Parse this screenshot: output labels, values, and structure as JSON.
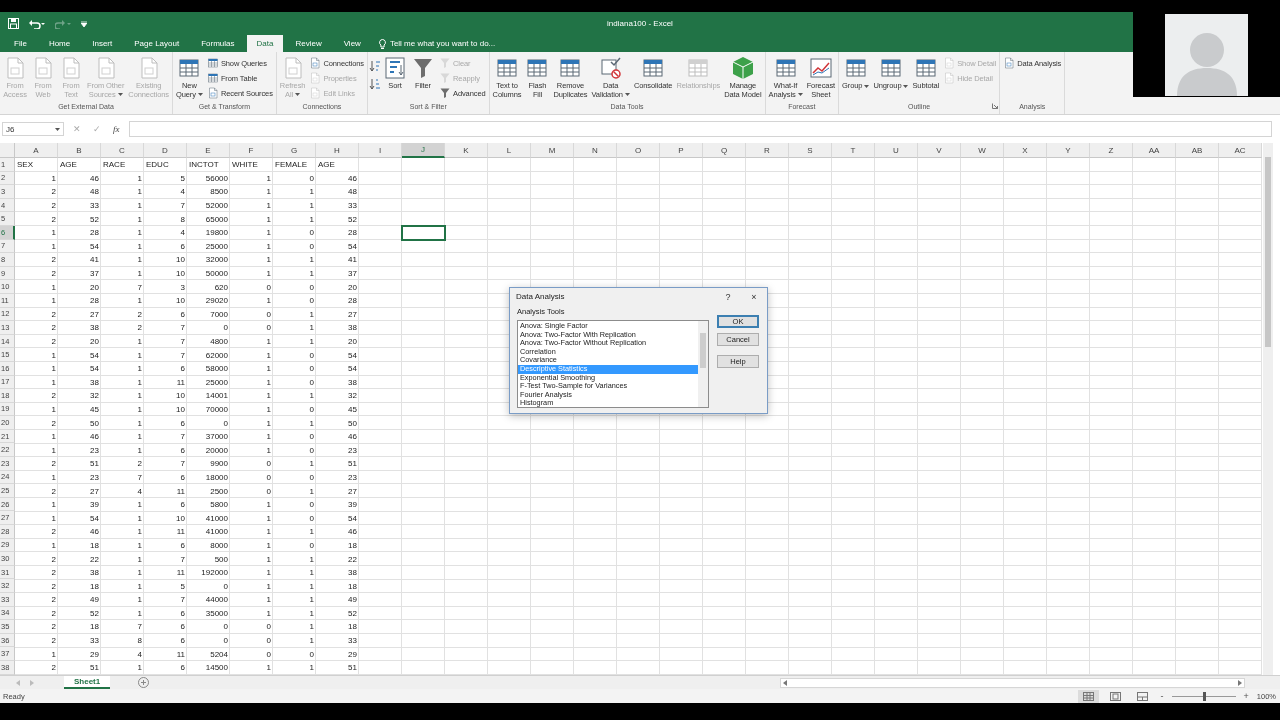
{
  "window": {
    "title": "indiana100 - Excel"
  },
  "tabs": [
    {
      "label": "File",
      "selected": false
    },
    {
      "label": "Home",
      "selected": false
    },
    {
      "label": "Insert",
      "selected": false
    },
    {
      "label": "Page Layout",
      "selected": false
    },
    {
      "label": "Formulas",
      "selected": false
    },
    {
      "label": "Data",
      "selected": true
    },
    {
      "label": "Review",
      "selected": false
    },
    {
      "label": "View",
      "selected": false
    }
  ],
  "tell_me": {
    "placeholder": "Tell me what you want to do..."
  },
  "ribbon": {
    "groups": [
      {
        "label": "Get External Data",
        "launcher": false,
        "items": [
          {
            "kind": "large",
            "label": "From\nAccess",
            "disabled": true,
            "menu": false
          },
          {
            "kind": "large",
            "label": "From\nWeb",
            "disabled": true,
            "menu": false
          },
          {
            "kind": "large",
            "label": "From\nText",
            "disabled": true,
            "menu": false
          },
          {
            "kind": "large",
            "label": "From Other\nSources",
            "disabled": true,
            "menu": true
          },
          {
            "kind": "large",
            "label": "Existing\nConnections",
            "disabled": true,
            "menu": false
          }
        ]
      },
      {
        "label": "Get & Transform",
        "launcher": false,
        "items": [
          {
            "kind": "large",
            "label": "New\nQuery",
            "disabled": false,
            "menu": true
          },
          {
            "kind": "stack",
            "items": [
              {
                "label": "Show Queries",
                "disabled": false
              },
              {
                "label": "From Table",
                "disabled": false
              },
              {
                "label": "Recent Sources",
                "disabled": false
              }
            ]
          }
        ]
      },
      {
        "label": "Connections",
        "launcher": false,
        "items": [
          {
            "kind": "large",
            "label": "Refresh\nAll",
            "disabled": true,
            "menu": true
          },
          {
            "kind": "stack",
            "items": [
              {
                "label": "Connections",
                "disabled": false
              },
              {
                "label": "Properties",
                "disabled": true
              },
              {
                "label": "Edit Links",
                "disabled": true
              }
            ]
          }
        ]
      },
      {
        "label": "Sort & Filter",
        "launcher": false,
        "items": [
          {
            "kind": "sort_icons"
          },
          {
            "kind": "large",
            "label": "Sort",
            "disabled": false,
            "menu": false
          },
          {
            "kind": "large",
            "label": "Filter",
            "disabled": false,
            "menu": false
          },
          {
            "kind": "stack",
            "items": [
              {
                "label": "Clear",
                "disabled": true
              },
              {
                "label": "Reapply",
                "disabled": true
              },
              {
                "label": "Advanced",
                "disabled": false
              }
            ]
          }
        ]
      },
      {
        "label": "Data Tools",
        "launcher": false,
        "items": [
          {
            "kind": "large",
            "label": "Text to\nColumns",
            "disabled": false,
            "menu": false
          },
          {
            "kind": "large",
            "label": "Flash\nFill",
            "disabled": false,
            "menu": false
          },
          {
            "kind": "large",
            "label": "Remove\nDuplicates",
            "disabled": false,
            "menu": false
          },
          {
            "kind": "large",
            "label": "Data\nValidation",
            "disabled": false,
            "menu": true
          },
          {
            "kind": "large",
            "label": "Consolidate",
            "disabled": false,
            "menu": false
          },
          {
            "kind": "large",
            "label": "Relationships",
            "disabled": true,
            "menu": false
          },
          {
            "kind": "large",
            "label": "Manage\nData Model",
            "disabled": false,
            "menu": false
          }
        ]
      },
      {
        "label": "Forecast",
        "launcher": false,
        "items": [
          {
            "kind": "large",
            "label": "What-If\nAnalysis",
            "disabled": false,
            "menu": true
          },
          {
            "kind": "large",
            "label": "Forecast\nSheet",
            "disabled": false,
            "menu": false
          }
        ]
      },
      {
        "label": "Outline",
        "launcher": true,
        "items": [
          {
            "kind": "large",
            "label": "Group",
            "disabled": false,
            "menu": true
          },
          {
            "kind": "large",
            "label": "Ungroup",
            "disabled": false,
            "menu": true
          },
          {
            "kind": "large",
            "label": "Subtotal",
            "disabled": false,
            "menu": false
          },
          {
            "kind": "stack",
            "items": [
              {
                "label": "Show Detail",
                "disabled": true
              },
              {
                "label": "Hide Detail",
                "disabled": true
              }
            ]
          }
        ]
      },
      {
        "label": "Analysis",
        "launcher": false,
        "items": [
          {
            "kind": "stack",
            "items": [
              {
                "label": "Data Analysis",
                "disabled": false
              }
            ]
          }
        ]
      }
    ]
  },
  "formula_bar": {
    "name_box": "J6",
    "cancel": "✕",
    "enter": "✓",
    "insert_function": "fx"
  },
  "sheet": {
    "columns": [
      {
        "label": "A",
        "selected": false
      },
      {
        "label": "B",
        "selected": false
      },
      {
        "label": "C",
        "selected": false
      },
      {
        "label": "D",
        "selected": false
      },
      {
        "label": "E",
        "selected": false
      },
      {
        "label": "F",
        "selected": false
      },
      {
        "label": "G",
        "selected": false
      },
      {
        "label": "H",
        "selected": false
      },
      {
        "label": "I",
        "selected": false
      },
      {
        "label": "J",
        "selected": true
      },
      {
        "label": "K",
        "selected": false
      },
      {
        "label": "L",
        "selected": false
      },
      {
        "label": "M",
        "selected": false
      },
      {
        "label": "N",
        "selected": false
      },
      {
        "label": "O",
        "selected": false
      },
      {
        "label": "P",
        "selected": false
      },
      {
        "label": "Q",
        "selected": false
      },
      {
        "label": "R",
        "selected": false
      },
      {
        "label": "S",
        "selected": false
      },
      {
        "label": "T",
        "selected": false
      },
      {
        "label": "U",
        "selected": false
      },
      {
        "label": "V",
        "selected": false
      },
      {
        "label": "W",
        "selected": false
      },
      {
        "label": "X",
        "selected": false
      },
      {
        "label": "Y",
        "selected": false
      },
      {
        "label": "Z",
        "selected": false
      },
      {
        "label": "AA",
        "selected": false
      },
      {
        "label": "AB",
        "selected": false
      },
      {
        "label": "AC",
        "selected": false
      }
    ],
    "rows": [
      {
        "number": "1",
        "selected": false,
        "kind": "labels",
        "cells": [
          "SEX",
          "AGE",
          "RACE",
          "EDUC",
          "INCTOT",
          "WHITE",
          "FEMALE",
          "AGE"
        ]
      },
      {
        "number": "2",
        "selected": false,
        "kind": "values",
        "cells": [
          "1",
          "46",
          "1",
          "5",
          "56000",
          "1",
          "0",
          "46"
        ]
      },
      {
        "number": "3",
        "selected": false,
        "kind": "values",
        "cells": [
          "2",
          "48",
          "1",
          "4",
          "8500",
          "1",
          "1",
          "48"
        ]
      },
      {
        "number": "4",
        "selected": false,
        "kind": "values",
        "cells": [
          "2",
          "33",
          "1",
          "7",
          "52000",
          "1",
          "1",
          "33"
        ]
      },
      {
        "number": "5",
        "selected": false,
        "kind": "values",
        "cells": [
          "2",
          "52",
          "1",
          "8",
          "65000",
          "1",
          "1",
          "52"
        ]
      },
      {
        "number": "6",
        "selected": true,
        "kind": "values",
        "cells": [
          "1",
          "28",
          "1",
          "4",
          "19800",
          "1",
          "0",
          "28"
        ]
      },
      {
        "number": "7",
        "selected": false,
        "kind": "values",
        "cells": [
          "1",
          "54",
          "1",
          "6",
          "25000",
          "1",
          "0",
          "54"
        ]
      },
      {
        "number": "8",
        "selected": false,
        "kind": "values",
        "cells": [
          "2",
          "41",
          "1",
          "10",
          "32000",
          "1",
          "1",
          "41"
        ]
      },
      {
        "number": "9",
        "selected": false,
        "kind": "values",
        "cells": [
          "2",
          "37",
          "1",
          "10",
          "50000",
          "1",
          "1",
          "37"
        ]
      },
      {
        "number": "10",
        "selected": false,
        "kind": "values",
        "cells": [
          "1",
          "20",
          "7",
          "3",
          "620",
          "0",
          "0",
          "20"
        ]
      },
      {
        "number": "11",
        "selected": false,
        "kind": "values",
        "cells": [
          "1",
          "28",
          "1",
          "10",
          "29020",
          "1",
          "0",
          "28"
        ]
      },
      {
        "number": "12",
        "selected": false,
        "kind": "values",
        "cells": [
          "2",
          "27",
          "2",
          "6",
          "7000",
          "0",
          "1",
          "27"
        ]
      },
      {
        "number": "13",
        "selected": false,
        "kind": "values",
        "cells": [
          "2",
          "38",
          "2",
          "7",
          "0",
          "0",
          "1",
          "38"
        ]
      },
      {
        "number": "14",
        "selected": false,
        "kind": "values",
        "cells": [
          "2",
          "20",
          "1",
          "7",
          "4800",
          "1",
          "1",
          "20"
        ]
      },
      {
        "number": "15",
        "selected": false,
        "kind": "values",
        "cells": [
          "1",
          "54",
          "1",
          "7",
          "62000",
          "1",
          "0",
          "54"
        ]
      },
      {
        "number": "16",
        "selected": false,
        "kind": "values",
        "cells": [
          "1",
          "54",
          "1",
          "6",
          "58000",
          "1",
          "0",
          "54"
        ]
      },
      {
        "number": "17",
        "selected": false,
        "kind": "values",
        "cells": [
          "1",
          "38",
          "1",
          "11",
          "25000",
          "1",
          "0",
          "38"
        ]
      },
      {
        "number": "18",
        "selected": false,
        "kind": "values",
        "cells": [
          "2",
          "32",
          "1",
          "10",
          "14001",
          "1",
          "1",
          "32"
        ]
      },
      {
        "number": "19",
        "selected": false,
        "kind": "values",
        "cells": [
          "1",
          "45",
          "1",
          "10",
          "70000",
          "1",
          "0",
          "45"
        ]
      },
      {
        "number": "20",
        "selected": false,
        "kind": "values",
        "cells": [
          "2",
          "50",
          "1",
          "6",
          "0",
          "1",
          "1",
          "50"
        ]
      },
      {
        "number": "21",
        "selected": false,
        "kind": "values",
        "cells": [
          "1",
          "46",
          "1",
          "7",
          "37000",
          "1",
          "0",
          "46"
        ]
      },
      {
        "number": "22",
        "selected": false,
        "kind": "values",
        "cells": [
          "1",
          "23",
          "1",
          "6",
          "20000",
          "1",
          "0",
          "23"
        ]
      },
      {
        "number": "23",
        "selected": false,
        "kind": "values",
        "cells": [
          "2",
          "51",
          "2",
          "7",
          "9900",
          "0",
          "1",
          "51"
        ]
      },
      {
        "number": "24",
        "selected": false,
        "kind": "values",
        "cells": [
          "1",
          "23",
          "7",
          "6",
          "18000",
          "0",
          "0",
          "23"
        ]
      },
      {
        "number": "25",
        "selected": false,
        "kind": "values",
        "cells": [
          "2",
          "27",
          "4",
          "11",
          "2500",
          "0",
          "1",
          "27"
        ]
      },
      {
        "number": "26",
        "selected": false,
        "kind": "values",
        "cells": [
          "1",
          "39",
          "1",
          "6",
          "5800",
          "1",
          "0",
          "39"
        ]
      },
      {
        "number": "27",
        "selected": false,
        "kind": "values",
        "cells": [
          "1",
          "54",
          "1",
          "10",
          "41000",
          "1",
          "0",
          "54"
        ]
      },
      {
        "number": "28",
        "selected": false,
        "kind": "values",
        "cells": [
          "2",
          "46",
          "1",
          "11",
          "41000",
          "1",
          "1",
          "46"
        ]
      },
      {
        "number": "29",
        "selected": false,
        "kind": "values",
        "cells": [
          "1",
          "18",
          "1",
          "6",
          "8000",
          "1",
          "0",
          "18"
        ]
      },
      {
        "number": "30",
        "selected": false,
        "kind": "values",
        "cells": [
          "2",
          "22",
          "1",
          "7",
          "500",
          "1",
          "1",
          "22"
        ]
      },
      {
        "number": "31",
        "selected": false,
        "kind": "values",
        "cells": [
          "2",
          "38",
          "1",
          "11",
          "192000",
          "1",
          "1",
          "38"
        ]
      },
      {
        "number": "32",
        "selected": false,
        "kind": "values",
        "cells": [
          "2",
          "18",
          "1",
          "5",
          "0",
          "1",
          "1",
          "18"
        ]
      },
      {
        "number": "33",
        "selected": false,
        "kind": "values",
        "cells": [
          "2",
          "49",
          "1",
          "7",
          "44000",
          "1",
          "1",
          "49"
        ]
      },
      {
        "number": "34",
        "selected": false,
        "kind": "values",
        "cells": [
          "2",
          "52",
          "1",
          "6",
          "35000",
          "1",
          "1",
          "52"
        ]
      },
      {
        "number": "35",
        "selected": false,
        "kind": "values",
        "cells": [
          "2",
          "18",
          "7",
          "6",
          "0",
          "0",
          "1",
          "18"
        ]
      },
      {
        "number": "36",
        "selected": false,
        "kind": "values",
        "cells": [
          "2",
          "33",
          "8",
          "6",
          "0",
          "0",
          "1",
          "33"
        ]
      },
      {
        "number": "37",
        "selected": false,
        "kind": "values",
        "cells": [
          "1",
          "29",
          "4",
          "11",
          "5204",
          "0",
          "0",
          "29"
        ]
      },
      {
        "number": "38",
        "selected": false,
        "kind": "values",
        "cells": [
          "2",
          "51",
          "1",
          "6",
          "14500",
          "1",
          "1",
          "51"
        ]
      }
    ]
  },
  "dialog": {
    "title": "Data Analysis",
    "help": "?",
    "close": "×",
    "list_label": "Analysis Tools",
    "tools": [
      {
        "label": "Anova: Single Factor",
        "selected": false
      },
      {
        "label": "Anova: Two-Factor With Replication",
        "selected": false
      },
      {
        "label": "Anova: Two-Factor Without Replication",
        "selected": false
      },
      {
        "label": "Correlation",
        "selected": false
      },
      {
        "label": "Covariance",
        "selected": false
      },
      {
        "label": "Descriptive Statistics",
        "selected": true
      },
      {
        "label": "Exponential Smoothing",
        "selected": false
      },
      {
        "label": "F-Test Two-Sample for Variances",
        "selected": false
      },
      {
        "label": "Fourier Analysis",
        "selected": false
      },
      {
        "label": "Histogram",
        "selected": false
      }
    ],
    "buttons": [
      "OK",
      "Cancel",
      "Help"
    ]
  },
  "sheet_tabs": [
    {
      "label": "Sheet1",
      "selected": true
    }
  ],
  "status_bar": {
    "text": "Ready",
    "views": [
      {
        "selected": true
      },
      {
        "selected": false
      },
      {
        "selected": false
      }
    ],
    "zoom": {
      "minus": "-",
      "plus": "+",
      "level": 0.5,
      "value": "100%"
    }
  }
}
